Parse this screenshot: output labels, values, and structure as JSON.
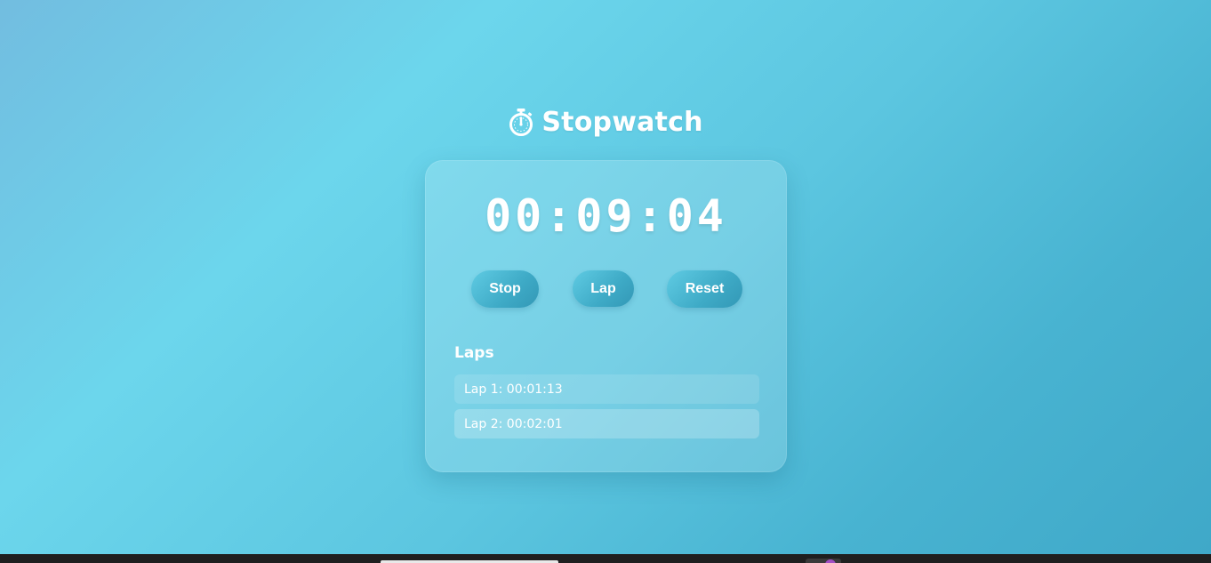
{
  "app": {
    "title": "Stopwatch",
    "title_icon": "stopwatch-icon"
  },
  "timer": {
    "display": "00:09:04"
  },
  "controls": {
    "stop_label": "Stop",
    "lap_label": "Lap",
    "reset_label": "Reset"
  },
  "laps": {
    "heading": "Laps",
    "items": [
      {
        "label": "Lap 1: 00:01:13"
      },
      {
        "label": "Lap 2: 00:02:01"
      }
    ]
  },
  "colors": {
    "background_start": "#72bde0",
    "background_end": "#3fa8c8",
    "button": "#3eaac6",
    "text": "#ffffff",
    "taskbar": "#1f1f1f"
  }
}
